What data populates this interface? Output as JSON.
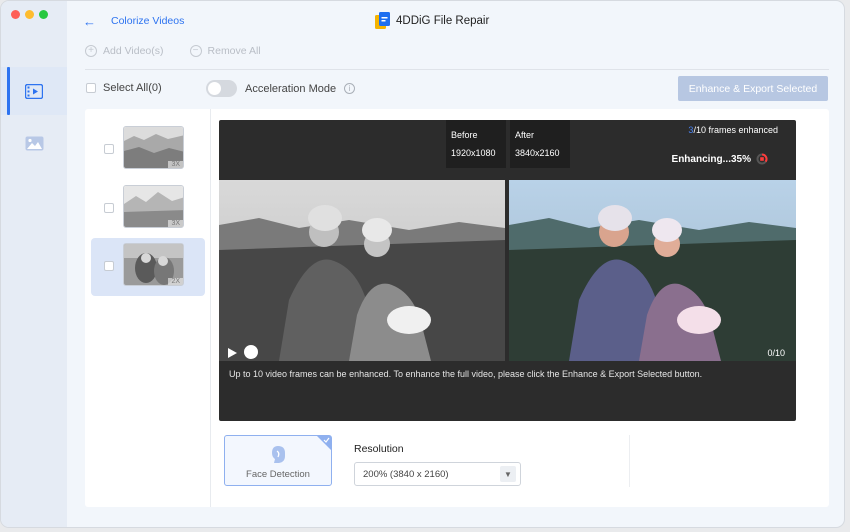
{
  "window": {
    "title": "4DDiG File Repair"
  },
  "header": {
    "back_title": "Colorize Videos"
  },
  "toolbar": {
    "add_label": "Add Video(s)",
    "remove_label": "Remove All"
  },
  "controls": {
    "select_all": "Select All(0)",
    "acceleration": "Acceleration Mode",
    "enhance_button": "Enhance & Export Selected"
  },
  "thumbnails": [
    {
      "badge": "3X",
      "selected": false
    },
    {
      "badge": "3X",
      "selected": false
    },
    {
      "badge": "2X",
      "selected": true
    }
  ],
  "viewer": {
    "before_label": "Before",
    "before_res": "1920x1080",
    "after_label": "After",
    "after_res": "3840x2160",
    "frames_current": "3",
    "frames_rest": "/10 frames enhanced",
    "enhancing": "Enhancing...35%",
    "progress_percent": 35,
    "counter": "0/10",
    "note": "Up to 10 video frames can be enhanced. To enhance the full video, please click the Enhance & Export Selected button."
  },
  "options": {
    "face_detection": "Face Detection",
    "resolution_title": "Resolution",
    "resolution_value": "200% (3840 x 2160)"
  },
  "colors": {
    "accent": "#2d73f0",
    "enhance_btn": "#b7c7e2"
  }
}
